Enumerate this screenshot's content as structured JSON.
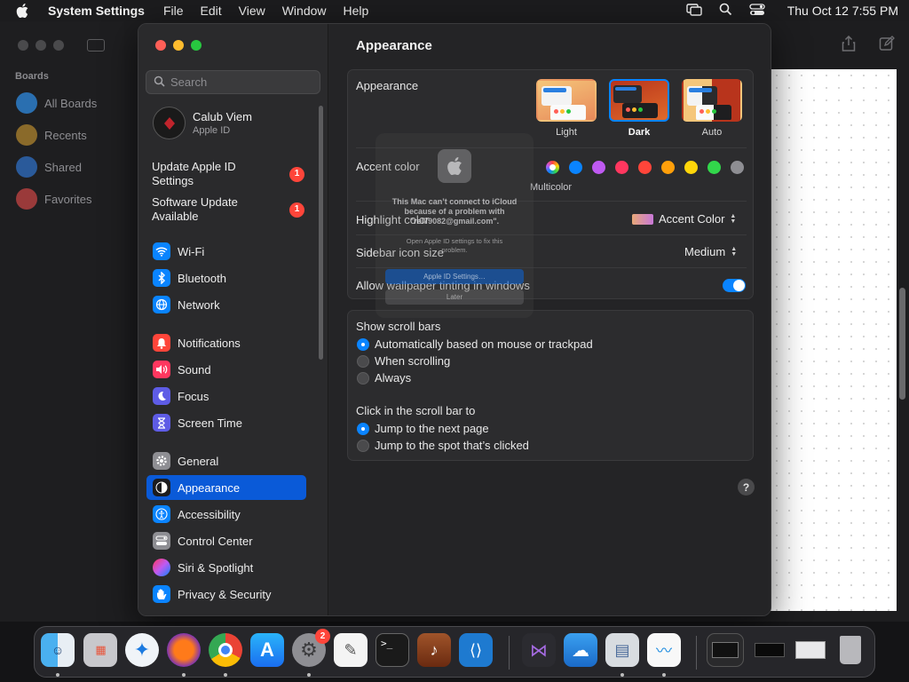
{
  "menubar": {
    "app_name": "System Settings",
    "menus": [
      "File",
      "Edit",
      "View",
      "Window",
      "Help"
    ],
    "clock": "Thu Oct 12  7:55 PM"
  },
  "background_app": {
    "section_title": "Boards",
    "items": [
      "All Boards",
      "Recents",
      "Shared",
      "Favorites"
    ]
  },
  "sidebar": {
    "search_placeholder": "Search",
    "account": {
      "name": "Calub Viem",
      "subtitle": "Apple ID"
    },
    "updates": [
      {
        "label_line1": "Update Apple ID",
        "label_line2": "Settings",
        "count": "1"
      },
      {
        "label_line1": "Software Update",
        "label_line2": "Available",
        "count": "1"
      }
    ],
    "items": [
      {
        "label": "Wi-Fi",
        "icon": "wifi-icon",
        "color": "#0a84ff"
      },
      {
        "label": "Bluetooth",
        "icon": "bluetooth-icon",
        "color": "#0a84ff"
      },
      {
        "label": "Network",
        "icon": "network-icon",
        "color": "#0a84ff"
      },
      {
        "label": "Notifications",
        "icon": "bell-icon",
        "color": "#ff453a"
      },
      {
        "label": "Sound",
        "icon": "speaker-icon",
        "color": "#ff375f"
      },
      {
        "label": "Focus",
        "icon": "moon-icon",
        "color": "#5e5ce6"
      },
      {
        "label": "Screen Time",
        "icon": "hourglass-icon",
        "color": "#5e5ce6"
      },
      {
        "label": "General",
        "icon": "gear-icon",
        "color": "#8e8e93"
      },
      {
        "label": "Appearance",
        "icon": "appearance-icon",
        "color": "#1c1c1e"
      },
      {
        "label": "Accessibility",
        "icon": "accessibility-icon",
        "color": "#0a84ff"
      },
      {
        "label": "Control Center",
        "icon": "control-center-icon",
        "color": "#8e8e93"
      },
      {
        "label": "Siri & Spotlight",
        "icon": "siri-icon",
        "color": "#bf5af2"
      },
      {
        "label": "Privacy & Security",
        "icon": "hand-icon",
        "color": "#0a84ff"
      }
    ],
    "active": "Appearance"
  },
  "content": {
    "title": "Appearance",
    "appearance": {
      "label": "Appearance",
      "options": [
        "Light",
        "Dark",
        "Auto"
      ],
      "selected": "Dark"
    },
    "accent": {
      "label": "Accent color",
      "multicolor_label": "Multicolor",
      "colors": [
        "#0a84ff",
        "#bf5af2",
        "#ff375f",
        "#ff453a",
        "#ff9f0a",
        "#ffd60a",
        "#32d74b",
        "#8e8e93"
      ]
    },
    "highlight": {
      "label": "Highlight color",
      "value": "Accent Color"
    },
    "sidebar_icon": {
      "label": "Sidebar icon size",
      "value": "Medium"
    },
    "wallpaper_tinting": {
      "label": "Allow wallpaper tinting in windows",
      "on": true
    },
    "scroll_bars": {
      "label": "Show scroll bars",
      "options": [
        "Automatically based on mouse or trackpad",
        "When scrolling",
        "Always"
      ],
      "selected": 0
    },
    "click_scroll": {
      "label": "Click in the scroll bar to",
      "options": [
        "Jump to the next page",
        "Jump to the spot that’s clicked"
      ],
      "selected": 0
    },
    "help": "?"
  },
  "alert": {
    "message": "This Mac can’t connect to iCloud because of a problem with \"rel79082@gmail.com\".",
    "detail": "Open Apple ID settings to fix this problem.",
    "primary_button": "Apple ID Settings…",
    "secondary_button": "Later"
  },
  "dock": {
    "apps": [
      "Finder",
      "Launchpad",
      "Safari",
      "Firefox",
      "Chrome",
      "App Store",
      "System Settings",
      "TextEdit",
      "Terminal",
      "Instruments",
      "VS Code",
      "Visual Studio",
      "Weather",
      "Preview",
      "Freeform",
      "Chrome Window",
      "Window",
      "Window",
      "Trash"
    ],
    "settings_badge": "2"
  }
}
